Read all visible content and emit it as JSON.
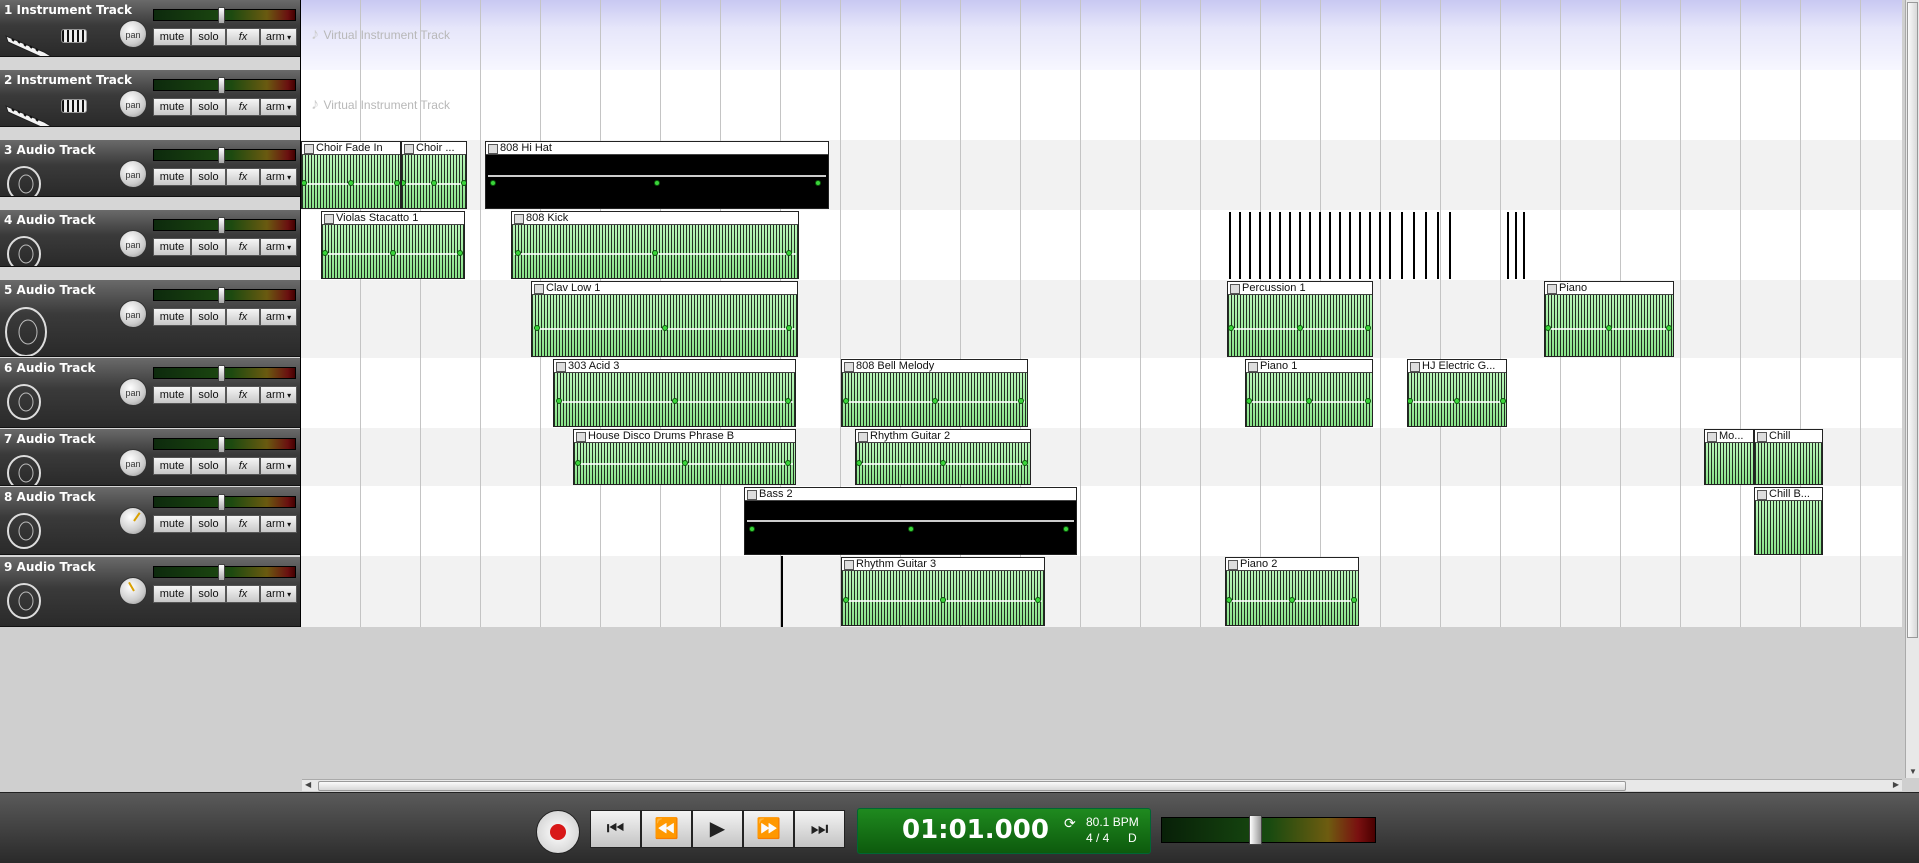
{
  "tracks": [
    {
      "name": "1  Instrument Track",
      "type": "instrument",
      "pan": "pan"
    },
    {
      "name": "2  Instrument Track",
      "type": "instrument",
      "pan": "pan"
    },
    {
      "name": "3  Audio Track",
      "type": "audio",
      "pan": "pan"
    },
    {
      "name": "4  Audio Track",
      "type": "audio",
      "pan": "pan"
    },
    {
      "name": "5  Audio Track",
      "type": "audio",
      "pan": "pan"
    },
    {
      "name": "6  Audio Track",
      "type": "audio",
      "pan": "pan"
    },
    {
      "name": "7  Audio Track",
      "type": "audio",
      "pan": "pan"
    },
    {
      "name": "8  Audio Track",
      "type": "audio",
      "pan": ""
    },
    {
      "name": "9  Audio Track",
      "type": "audio",
      "pan": ""
    }
  ],
  "track_buttons": {
    "mute": "mute",
    "solo": "solo",
    "fx": "fx",
    "arm": "arm"
  },
  "virtual_instrument_hint": "Virtual Instrument Track",
  "clips": [
    {
      "name": "Choir Fade In",
      "track": 3,
      "selected": true
    },
    {
      "name": "Choir ...",
      "track": 3,
      "selected": true
    },
    {
      "name": "808 Hi Hat",
      "track": 3,
      "selected": false
    },
    {
      "name": "Violas Stacatto 1",
      "track": 4,
      "selected": true
    },
    {
      "name": "808 Kick",
      "track": 4,
      "selected": true
    },
    {
      "name": "Clav Low 1",
      "track": 5,
      "selected": true
    },
    {
      "name": "Percussion 1",
      "track": 5,
      "selected": true
    },
    {
      "name": "Piano",
      "track": 5,
      "selected": true
    },
    {
      "name": "303 Acid 3",
      "track": 6,
      "selected": true
    },
    {
      "name": "808 Bell Melody",
      "track": 6,
      "selected": true
    },
    {
      "name": "Piano 1",
      "track": 6,
      "selected": true
    },
    {
      "name": "HJ Electric G...",
      "track": 6,
      "selected": true
    },
    {
      "name": "House Disco Drums Phrase B",
      "track": 7,
      "selected": true
    },
    {
      "name": "Rhythm Guitar 2",
      "track": 7,
      "selected": true
    },
    {
      "name": "Mo...",
      "track": 7,
      "selected": true
    },
    {
      "name": "Chill",
      "track": 7,
      "selected": true
    },
    {
      "name": "Bass 2",
      "track": 8,
      "selected": false
    },
    {
      "name": "Chill B...",
      "track": 8,
      "selected": true
    },
    {
      "name": "Rhythm Guitar 3",
      "track": 9,
      "selected": true
    },
    {
      "name": "Piano 2",
      "track": 9,
      "selected": true
    }
  ],
  "transport": {
    "time": "01:01.000",
    "bpm": "80.1 BPM",
    "signature": "4 / 4",
    "key": "D",
    "buttons": [
      "⏮",
      "⏪",
      "▶",
      "⏩",
      "⏭"
    ]
  },
  "colors": {
    "selected_clip": "#8ae38a",
    "timeline_lane_instrument": "#e6e6fa",
    "time_display": "#1f8a1f",
    "record": "#d81818"
  }
}
